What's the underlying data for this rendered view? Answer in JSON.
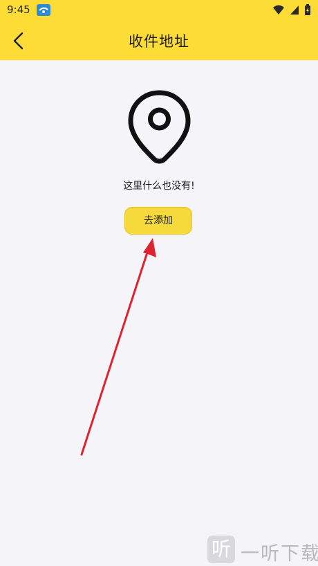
{
  "status_bar": {
    "time": "9:45",
    "icons": [
      "app-notification-icon",
      "wifi-icon",
      "signal-icon",
      "battery-icon"
    ]
  },
  "app_bar": {
    "title": "收件地址",
    "back_icon": "chevron-left-icon"
  },
  "empty_state": {
    "icon": "location-pin-icon",
    "message": "这里什么也没有!",
    "button_label": "去添加"
  },
  "annotation": {
    "type": "red-arrow",
    "color": "#e0212e",
    "points_to": "add-button"
  },
  "watermark": {
    "logo_char": "听",
    "text": "一听下载"
  },
  "colors": {
    "header": "#fcdc35",
    "button": "#f6d93a",
    "background": "#f5f4f9",
    "text": "#1e1e1e"
  }
}
